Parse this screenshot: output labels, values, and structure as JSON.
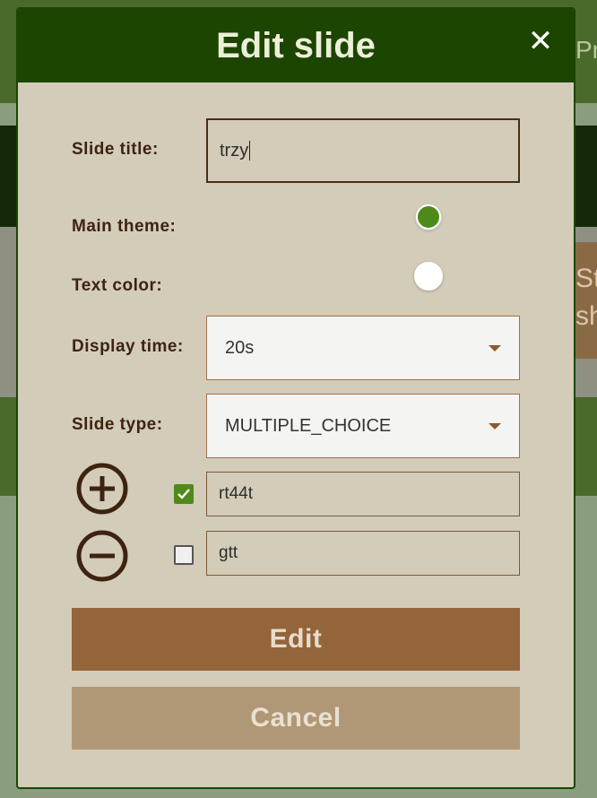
{
  "background": {
    "right_text": "Pr",
    "card_text_1": "St",
    "card_text_2": "sh"
  },
  "modal": {
    "title": "Edit slide",
    "close_icon": "close-icon",
    "fields": {
      "slide_title_label": "Slide title:",
      "slide_title_value": "trzy",
      "main_theme_label": "Main theme:",
      "main_theme_color": "#4e8a1a",
      "text_color_label": "Text color:",
      "text_color_value": "#ffffff",
      "display_time_label": "Display time:",
      "display_time_value": "20s",
      "slide_type_label": "Slide type:",
      "slide_type_value": "MULTIPLE_CHOICE"
    },
    "answers": [
      {
        "text": "rt44t",
        "checked": true
      },
      {
        "text": "gtt",
        "checked": false
      }
    ],
    "buttons": {
      "add_icon": "plus-circle-icon",
      "remove_icon": "minus-circle-icon",
      "edit_label": "Edit",
      "cancel_label": "Cancel"
    }
  },
  "colors": {
    "header": "#1c4502",
    "modal_bg": "#d3ccb9",
    "edit_button": "#94643a",
    "cancel_button": "#b09877",
    "label_text": "#3d2410"
  }
}
